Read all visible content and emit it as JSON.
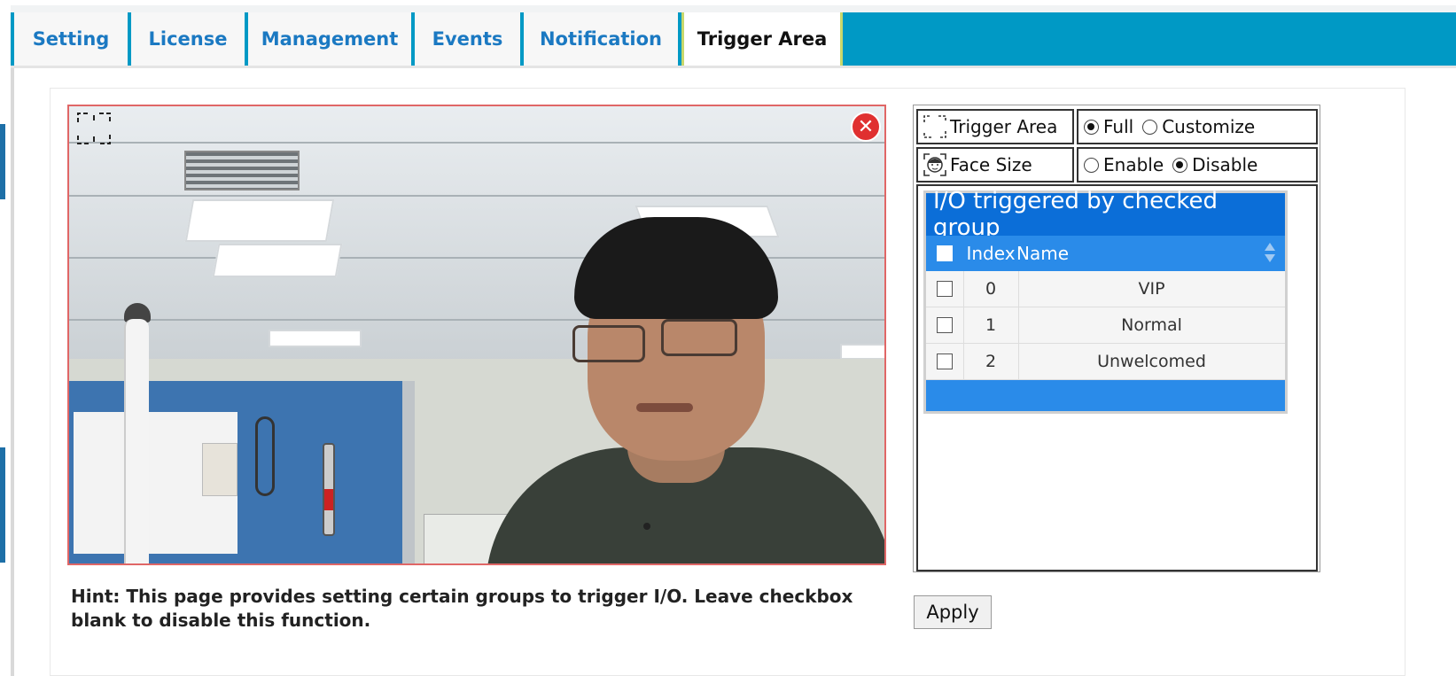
{
  "tabs": [
    {
      "label": "Setting",
      "active": false
    },
    {
      "label": "License",
      "active": false
    },
    {
      "label": "Management",
      "active": false
    },
    {
      "label": "Events",
      "active": false
    },
    {
      "label": "Notification",
      "active": false
    },
    {
      "label": "Trigger Area",
      "active": true
    }
  ],
  "settings": {
    "trigger_area": {
      "label": "Trigger Area",
      "options": [
        "Full",
        "Customize"
      ],
      "selected": "Full"
    },
    "face_size": {
      "label": "Face Size",
      "options": [
        "Enable",
        "Disable"
      ],
      "selected": "Disable"
    }
  },
  "group_table": {
    "title": "I/O triggered by checked group",
    "columns": [
      "Index",
      "Name"
    ],
    "rows": [
      {
        "index": "0",
        "name": "VIP",
        "checked": false
      },
      {
        "index": "1",
        "name": "Normal",
        "checked": false
      },
      {
        "index": "2",
        "name": "Unwelcomed",
        "checked": false
      }
    ]
  },
  "hint": "Hint: This page provides setting certain groups to trigger I/O. Leave checkbox blank to disable this function.",
  "apply_label": "Apply",
  "colors": {
    "tab_bar": "#0099c5",
    "tab_text": "#1b79c2",
    "table_title_bg": "#0b6ed8",
    "table_head_bg": "#2a8be9",
    "camera_border": "#e06666",
    "close_button": "#e03030"
  },
  "icons": {
    "camera_corner": "selection-frame-icon",
    "close": "close-icon",
    "trigger_area": "selection-frame-icon",
    "face_size": "face-icon",
    "sort": "sort-icon"
  }
}
